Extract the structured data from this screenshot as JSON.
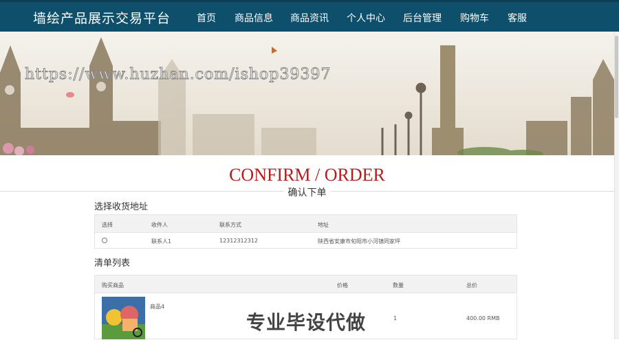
{
  "nav": {
    "brand": "墙绘产品展示交易平台",
    "items": [
      {
        "label": "首页"
      },
      {
        "label": "商品信息"
      },
      {
        "label": "商品资讯"
      },
      {
        "label": "个人中心"
      },
      {
        "label": "后台管理"
      },
      {
        "label": "购物车"
      },
      {
        "label": "客服"
      }
    ],
    "active_index": 1
  },
  "banner": {
    "watermark_url": "https://www.huzhan.com/ishop39397"
  },
  "page": {
    "title_en": "CONFIRM / ORDER",
    "title_cn": "确认下单"
  },
  "address": {
    "section_title": "选择收货地址",
    "columns": [
      "选择",
      "收件人",
      "联系方式",
      "地址"
    ],
    "rows": [
      {
        "recipient": "联系人1",
        "phone": "12312312312",
        "address": "陕西省安康市旬阳市小河镇同家坪"
      }
    ]
  },
  "orderlist": {
    "section_title": "清单列表",
    "columns": [
      "购买商品",
      "价格",
      "数量",
      "总价"
    ],
    "rows": [
      {
        "name": "商品4",
        "price": "",
        "quantity": "1",
        "total": "400.00 RMB"
      }
    ]
  },
  "overlay": {
    "watermark_text": "专业毕设代做"
  }
}
